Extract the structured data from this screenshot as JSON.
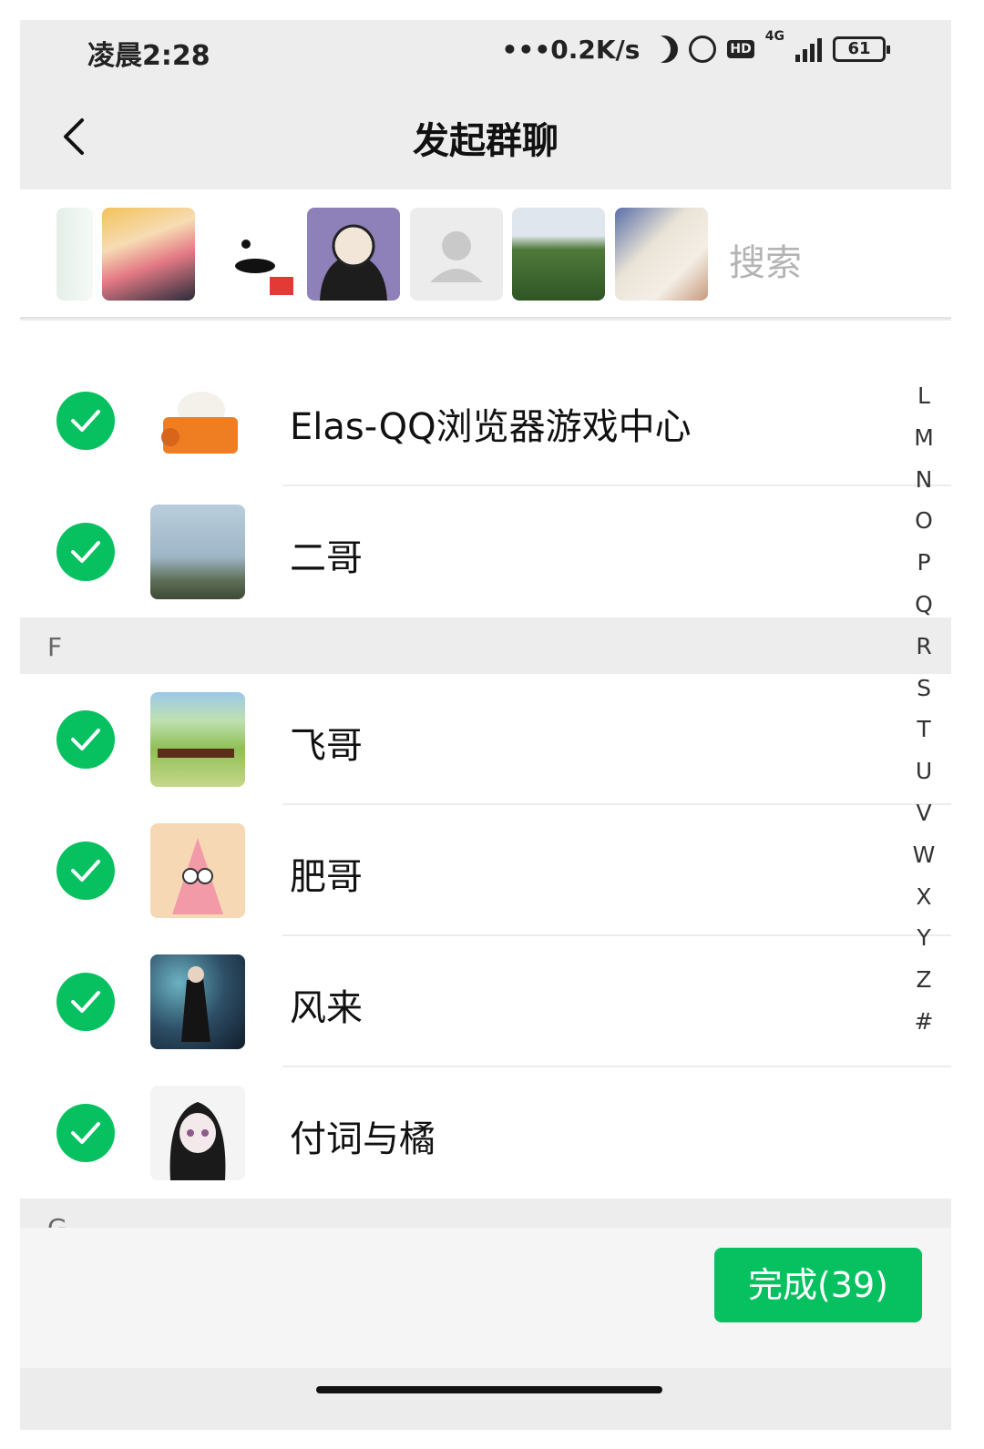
{
  "status_bar": {
    "time": "凌晨2:28",
    "net_speed": "•••0.2K/s",
    "hd_label": "HD",
    "network_type": "4G",
    "battery": "61",
    "icons": [
      "moon-icon",
      "alarm-icon",
      "hd-icon",
      "signal-icon",
      "battery-icon"
    ]
  },
  "header": {
    "title": "发起群聊",
    "back_icon": "chevron-left-icon"
  },
  "selected_strip": {
    "search_placeholder": "搜索",
    "avatars": [
      "partial-avatar",
      "anime-girl-avatar",
      "ink-cat-avatar",
      "hoodie-boy-avatar",
      "default-avatar",
      "hill-photo-avatar",
      "white-cat-avatar"
    ]
  },
  "contacts": [
    {
      "name": "Elas-QQ浏览器游戏中心",
      "checked": true,
      "avatar": "bunny-cup-avatar"
    },
    {
      "name": "二哥",
      "checked": true,
      "avatar": "seaside-avatar"
    },
    {
      "section": "F"
    },
    {
      "name": "飞哥",
      "checked": true,
      "avatar": "horses-avatar"
    },
    {
      "name": "肥哥",
      "checked": true,
      "avatar": "patrick-avatar"
    },
    {
      "name": "风来",
      "checked": true,
      "avatar": "swordsman-avatar"
    },
    {
      "name": "付词与橘",
      "checked": true,
      "avatar": "catgirl-avatar"
    },
    {
      "section": "G"
    }
  ],
  "index_letters": [
    "L",
    "M",
    "N",
    "O",
    "P",
    "Q",
    "R",
    "S",
    "T",
    "U",
    "V",
    "W",
    "X",
    "Y",
    "Z",
    "#"
  ],
  "footer": {
    "done_label": "完成(39)"
  },
  "colors": {
    "accent_green": "#07c160",
    "background": "#ededed"
  }
}
